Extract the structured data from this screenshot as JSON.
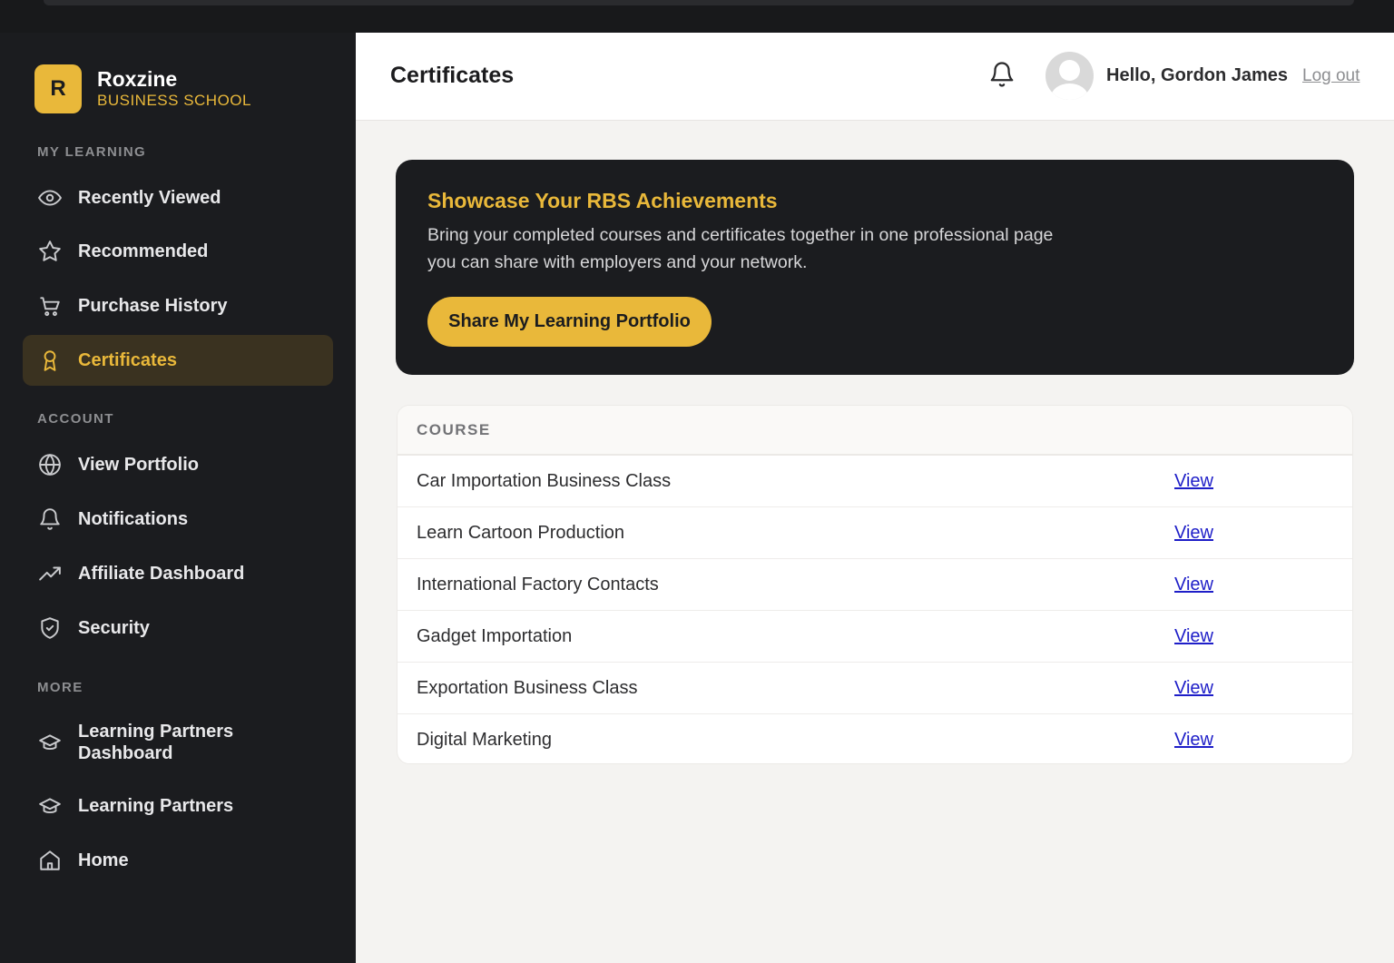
{
  "brand": {
    "logo_letter": "R",
    "name": "Roxzine",
    "subtitle": "BUSINESS SCHOOL",
    "accent": "#e9b83a"
  },
  "sidebar": {
    "sections": [
      {
        "label": "MY LEARNING"
      },
      {
        "label": "ACCOUNT"
      },
      {
        "label": "MORE"
      }
    ],
    "items": [
      {
        "label": "Recently Viewed",
        "icon": "eye-icon"
      },
      {
        "label": "Recommended",
        "icon": "star-icon"
      },
      {
        "label": "Purchase History",
        "icon": "cart-icon"
      },
      {
        "label": "Certificates",
        "icon": "award-icon",
        "active": true
      },
      {
        "label": "View Portfolio",
        "icon": "globe-icon"
      },
      {
        "label": "Notifications",
        "icon": "bell-icon"
      },
      {
        "label": "Affiliate Dashboard",
        "icon": "trending-up-icon"
      },
      {
        "label": "Security",
        "icon": "shield-icon"
      },
      {
        "label": "Learning Partners Dashboard",
        "icon": "graduation-cap-icon"
      },
      {
        "label": "Learning Partners",
        "icon": "graduation-cap-icon"
      },
      {
        "label": "Home",
        "icon": "home-icon"
      }
    ]
  },
  "header": {
    "title": "Certificates",
    "greeting": "Hello, Gordon James",
    "logout": "Log out"
  },
  "banner": {
    "title": "Showcase Your RBS Achievements",
    "text": "Bring your completed courses and certificates together in one professional page you can share with employers and your network.",
    "button": "Share My Learning Portfolio"
  },
  "table": {
    "column": "COURSE",
    "rows": [
      {
        "course": "Car Importation Business Class",
        "action": "View"
      },
      {
        "course": "Learn Cartoon Production",
        "action": "View"
      },
      {
        "course": "International Factory Contacts",
        "action": "View"
      },
      {
        "course": "Gadget Importation",
        "action": "View"
      },
      {
        "course": "Exportation Business Class",
        "action": "View"
      },
      {
        "course": "Digital Marketing",
        "action": "View"
      }
    ]
  }
}
